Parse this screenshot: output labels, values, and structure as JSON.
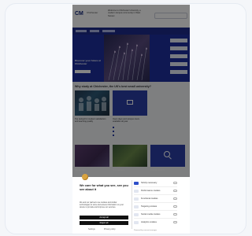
{
  "header": {
    "logo": "CM",
    "logo_sub": "Chichester",
    "intro_text": "Welcome to Chichester University, a modern campus community in West Sussex"
  },
  "hero": {
    "title": "Discover your future at Chichester"
  },
  "section": {
    "title": "Why study at Chichester, the UK's best small university?"
  },
  "column_texts": {
    "left": "Top ranked for student satisfaction and teaching quality",
    "right": "Open days and campus tours available all year"
  },
  "captions": {
    "photo2": "Student life",
    "photo3": "Our campus",
    "search": "Course search"
  },
  "consent": {
    "title": "We care for what you see, see you see about it",
    "body": "We and our partners use cookies and similar technologies to store and access information on your device to provide and improve our services.",
    "accept_label": "Accept all",
    "reject_label": "Reject all",
    "settings_link": "Settings",
    "privacy_link": "Privacy policy",
    "options": [
      "Strictly necessary",
      "Performance cookies",
      "Functional cookies",
      "Targeting cookies",
      "Social media cookies",
      "Analytics cookies"
    ],
    "powered_by": "Powered by consent manager"
  },
  "colors": {
    "brand": "#1e2f9e",
    "overlay": "rgba(0,0,0,0.48)",
    "accept_bg": "#111111"
  }
}
